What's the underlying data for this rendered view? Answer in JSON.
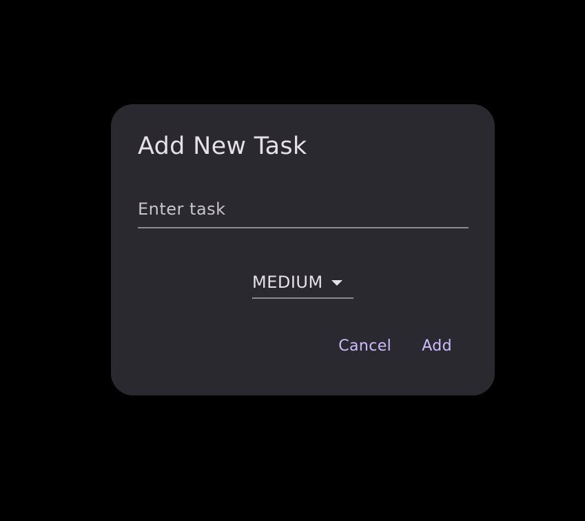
{
  "dialog": {
    "title": "Add New Task",
    "task_input": {
      "value": "",
      "placeholder": "Enter task"
    },
    "priority": {
      "selected": "MEDIUM",
      "icon": "dropdown-arrow-icon"
    },
    "actions": {
      "cancel_label": "Cancel",
      "add_label": "Add"
    }
  },
  "colors": {
    "background": "#000000",
    "dialog_surface": "#2a292f",
    "text_primary": "#e6e1e9",
    "accent": "#cfbcff",
    "divider": "#8e8a93"
  }
}
